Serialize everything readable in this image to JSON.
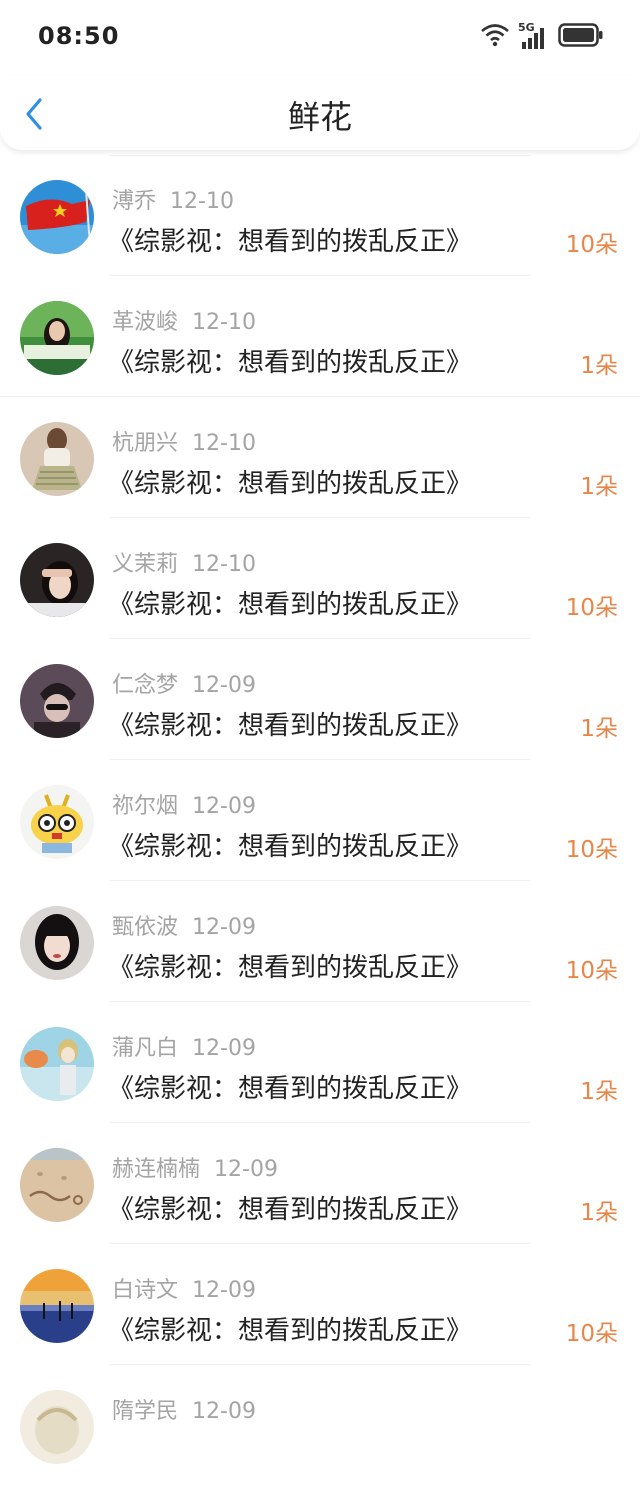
{
  "status": {
    "time": "08:50",
    "network": "5G"
  },
  "header": {
    "title": "鲜花"
  },
  "items": [
    {
      "name": "溥乔",
      "date": "12-10",
      "title": "《综影视：想看到的拨乱反正》",
      "count": "10朵"
    },
    {
      "name": "革波峻",
      "date": "12-10",
      "title": "《综影视：想看到的拨乱反正》",
      "count": "1朵"
    },
    {
      "name": "杭朋兴",
      "date": "12-10",
      "title": "《综影视：想看到的拨乱反正》",
      "count": "1朵"
    },
    {
      "name": "义茉莉",
      "date": "12-10",
      "title": "《综影视：想看到的拨乱反正》",
      "count": "10朵"
    },
    {
      "name": "仁念梦",
      "date": "12-09",
      "title": "《综影视：想看到的拨乱反正》",
      "count": "1朵"
    },
    {
      "name": "祢尔烟",
      "date": "12-09",
      "title": "《综影视：想看到的拨乱反正》",
      "count": "10朵"
    },
    {
      "name": "甄依波",
      "date": "12-09",
      "title": "《综影视：想看到的拨乱反正》",
      "count": "10朵"
    },
    {
      "name": "蒲凡白",
      "date": "12-09",
      "title": "《综影视：想看到的拨乱反正》",
      "count": "1朵"
    },
    {
      "name": "赫连楠楠",
      "date": "12-09",
      "title": "《综影视：想看到的拨乱反正》",
      "count": "1朵"
    },
    {
      "name": "白诗文",
      "date": "12-09",
      "title": "《综影视：想看到的拨乱反正》",
      "count": "10朵"
    },
    {
      "name": "隋学民",
      "date": "12-09",
      "title": "",
      "count": ""
    }
  ],
  "colors": {
    "accent": "#2f8ee8",
    "count": "#e8864a",
    "meta": "#a4a4a4",
    "text": "#222222"
  },
  "icons": {
    "back": "chevron-left-icon",
    "wifi": "wifi-icon",
    "signal": "signal-icon",
    "battery": "battery-icon"
  }
}
